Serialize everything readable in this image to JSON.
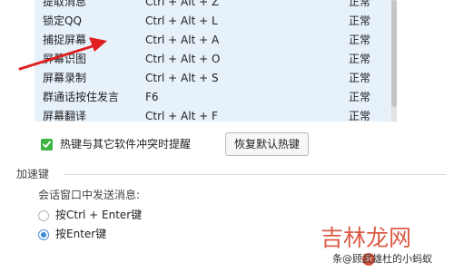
{
  "hotkeys": {
    "rows": [
      {
        "name": "提取消息",
        "key": "Ctrl + Alt + Z",
        "status": "正常"
      },
      {
        "name": "锁定QQ",
        "key": "Ctrl + Alt + L",
        "status": "正常"
      },
      {
        "name": "捕捉屏幕",
        "key": "Ctrl + Alt + A",
        "status": "正常"
      },
      {
        "name": "屏幕识图",
        "key": "Ctrl + Alt + O",
        "status": "正常"
      },
      {
        "name": "屏幕录制",
        "key": "Ctrl + Alt + S",
        "status": "正常"
      },
      {
        "name": "群通话按住发言",
        "key": "F6",
        "status": "正常"
      },
      {
        "name": "屏幕翻译",
        "key": "Ctrl + Alt + F",
        "status": "正常"
      }
    ]
  },
  "conflict": {
    "label": "热键与其它软件冲突时提醒",
    "checked": true
  },
  "restore_button": "恢复默认热键",
  "accelerator": {
    "title": "加速键",
    "send_label": "会话窗口中发送消息:",
    "options": [
      {
        "label": "按Ctrl + Enter键",
        "selected": false
      },
      {
        "label": "按Enter键",
        "selected": true
      }
    ]
  },
  "watermark": {
    "logo": "吉林龙网",
    "badge": "头",
    "text": "条@顾武雄杜的小蚂蚁"
  },
  "colors": {
    "table_bg": "#e7f1fa",
    "checkbox": "#3eb543",
    "radio_selected": "#3f8ad8",
    "arrow": "#e02020",
    "watermark": "#d84f36"
  }
}
